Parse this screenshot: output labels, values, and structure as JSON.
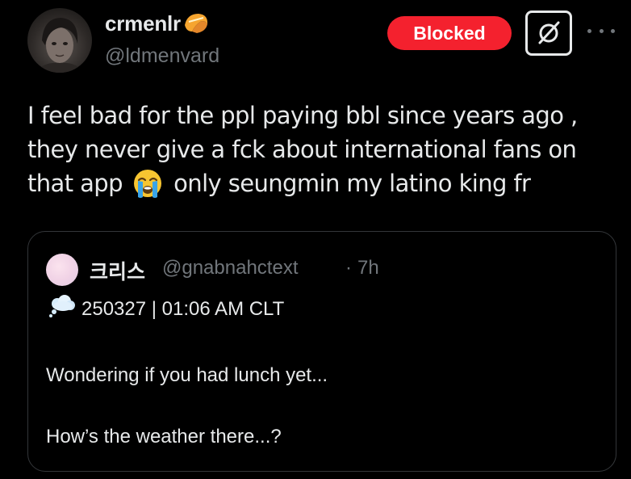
{
  "author": {
    "display_name": "crmenlr",
    "badge_icon": "fortune-cookie-icon",
    "handle": "@ldmenvard"
  },
  "actions": {
    "blocked_label": "Blocked",
    "grok_icon": "grok-icon",
    "more_icon": "more-icon"
  },
  "tweet": {
    "line1": "I feel bad for the ppl paying bbl since years ago ,",
    "line2": "they never give a fck about international fans on",
    "line3_before": "that app",
    "line3_emoji": "loudly-crying-face-emoji",
    "line3_after": "only seungmin my latino king fr"
  },
  "quote": {
    "display_name": "크리스",
    "handle": "@gnabnahctext",
    "separator": "·",
    "time": "7h",
    "stamp_icon": "thought-balloon-icon",
    "stamp": "250327 | 01:06 AM CLT",
    "line1": "Wondering if you had lunch yet...",
    "line2": "How’s the weather there...?"
  },
  "colors": {
    "background": "#000000",
    "text_primary": "#e7e9ea",
    "text_secondary": "#71767b",
    "blocked_red": "#f4212e",
    "border": "#333639"
  }
}
